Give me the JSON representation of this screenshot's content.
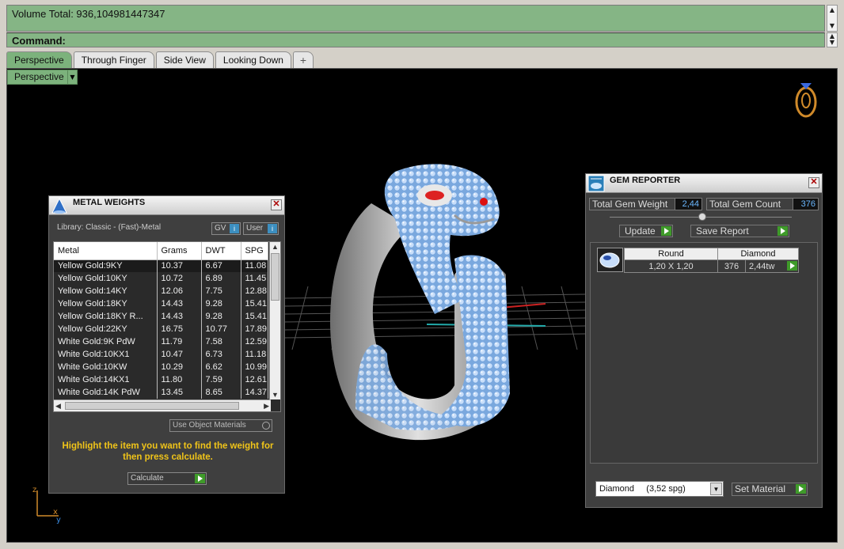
{
  "command_area": {
    "history_text": "Volume Total: 936,104981447347",
    "command_label": "Command:"
  },
  "tabs": [
    {
      "label": "Perspective"
    },
    {
      "label": "Through Finger"
    },
    {
      "label": "Side View"
    },
    {
      "label": "Looking Down"
    },
    {
      "label": "+"
    }
  ],
  "viewport": {
    "mode_label": "Perspective",
    "axis_labels": {
      "x": "x",
      "y": "y",
      "z": "z"
    }
  },
  "metal_weights": {
    "title": "METAL WEIGHTS",
    "library_label": "Library: Classic - (Fast)-Metal",
    "gv_label": "GV",
    "user_label": "User",
    "info_glyph": "i",
    "columns": [
      "Metal",
      "Grams",
      "DWT",
      "SPG"
    ],
    "rows": [
      [
        "Yellow Gold:9KY",
        "10.37",
        "6.67",
        "11.08"
      ],
      [
        "Yellow Gold:10KY",
        "10.72",
        "6.89",
        "11.45"
      ],
      [
        "Yellow Gold:14KY",
        "12.06",
        "7.75",
        "12.88"
      ],
      [
        "Yellow Gold:18KY",
        "14.43",
        "9.28",
        "15.41"
      ],
      [
        "Yellow Gold:18KY R...",
        "14.43",
        "9.28",
        "15.41"
      ],
      [
        "Yellow Gold:22KY",
        "16.75",
        "10.77",
        "17.89"
      ],
      [
        "White Gold:9K PdW",
        "11.79",
        "7.58",
        "12.59"
      ],
      [
        "White Gold:10KX1",
        "10.47",
        "6.73",
        "11.18"
      ],
      [
        "White Gold:10KW",
        "10.29",
        "6.62",
        "10.99"
      ],
      [
        "White Gold:14KX1",
        "11.80",
        "7.59",
        "12.61"
      ],
      [
        "White Gold:14K PdW",
        "13.45",
        "8.65",
        "14.37"
      ]
    ],
    "use_object_materials": "Use Object Materials",
    "hint": "Highlight the item you want to find the weight for then press calculate.",
    "calculate_label": "Calculate"
  },
  "gem_reporter": {
    "title": "GEM REPORTER",
    "total_weight_label": "Total Gem Weight",
    "total_weight_value": "2,44",
    "total_count_label": "Total Gem Count",
    "total_count_value": "376",
    "update_label": "Update",
    "save_report_label": "Save Report",
    "grid_headers": [
      "Round",
      "Diamond"
    ],
    "grid_row": {
      "size": "1,20 X 1,20",
      "count": "376",
      "weight": "2,44tw"
    },
    "material_select": "Diamond     (3,52 spg)",
    "set_material_label": "Set Material"
  },
  "colors": {
    "command_bg": "#85b585",
    "active_tab": "#7cb27c",
    "gem_value_text": "#6ab7ff",
    "hint_text": "#f0c419",
    "go_button": "#3f9b2a"
  },
  "icons": [
    "metal-weights-icon",
    "gem-reporter-icon",
    "ring-view-icon",
    "close-icon",
    "axis-indicator-icon"
  ]
}
